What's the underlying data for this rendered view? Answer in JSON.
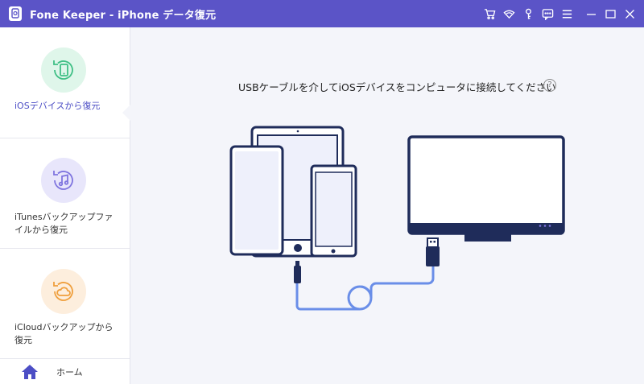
{
  "app": {
    "title": "Fone Keeper - iPhone データ復元"
  },
  "toolbar": {
    "icons": [
      "cart-icon",
      "wifi-icon",
      "key-icon",
      "chat-icon",
      "menu-icon"
    ],
    "window_controls": [
      "minimize-icon",
      "maximize-icon",
      "close-icon"
    ]
  },
  "sidebar": {
    "items": [
      {
        "label": "iOSデバイスから復元",
        "icon": "phone-restore-icon",
        "color": "#4ec78f",
        "active": true
      },
      {
        "label": "iTunesバックアップファイルから復元",
        "icon": "itunes-restore-icon",
        "color": "#8f86e6",
        "active": false
      },
      {
        "label": "iCloudバックアップから復元",
        "icon": "icloud-restore-icon",
        "color": "#f0a64a",
        "active": false
      }
    ],
    "home_label": "ホーム"
  },
  "main": {
    "instruction": "USBケーブルを介してiOSデバイスをコンピュータに接続してください",
    "help_symbol": "?"
  },
  "colors": {
    "titlebar": "#5b54c7",
    "accent": "#4c4ec5",
    "device_outline": "#1f2c5a",
    "cable": "#6a8ee8"
  }
}
